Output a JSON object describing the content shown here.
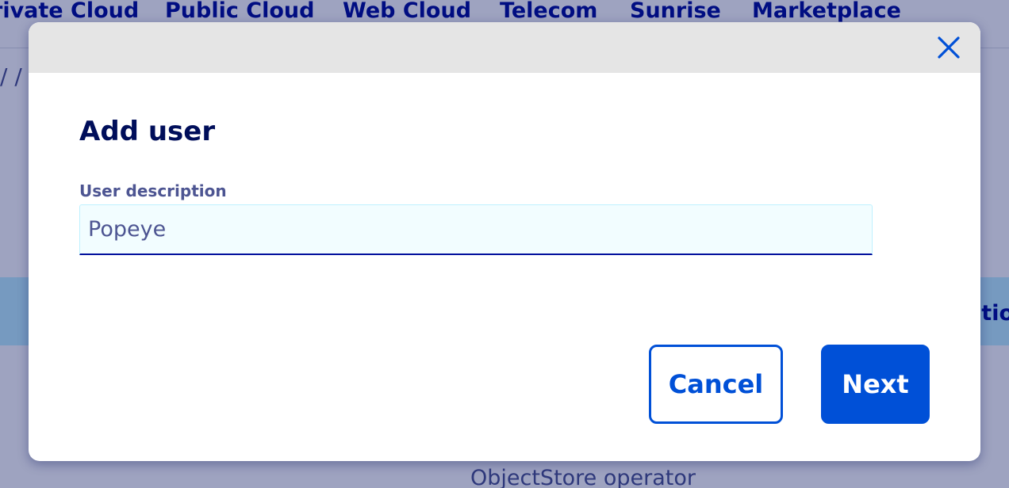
{
  "topnav": {
    "items": [
      {
        "label": "rivate Cloud"
      },
      {
        "label": "Public Cloud"
      },
      {
        "label": "Web Cloud"
      },
      {
        "label": "Telecom"
      },
      {
        "label": "Sunrise"
      },
      {
        "label": "Marketplace"
      }
    ]
  },
  "background": {
    "breadcrumb": "/ /",
    "table_header_label": "tio",
    "row_text": "ObjectStore operator"
  },
  "modal": {
    "title": "Add user",
    "close_icon": "close-icon",
    "field": {
      "label": "User description",
      "value": "Popeye"
    },
    "buttons": {
      "cancel": "Cancel",
      "next": "Next"
    }
  },
  "colors": {
    "primary": "#0050d7",
    "nav_text": "#000e9c",
    "title": "#000e5a",
    "label": "#4d5592",
    "input_bg": "#f2fdff",
    "header_bg": "#e5e5e5",
    "table_header_bg": "#bef1ff"
  }
}
